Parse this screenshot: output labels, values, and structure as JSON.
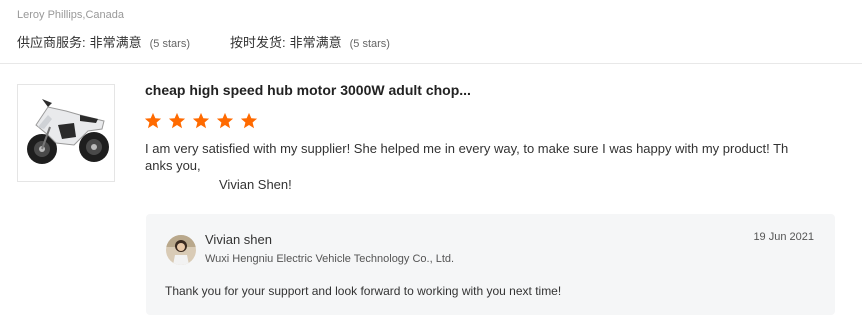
{
  "reviewer": {
    "name_location": "Leroy Phillips,Canada"
  },
  "ratings": [
    {
      "label": "供应商服务:",
      "value": "非常满意",
      "stars_text": "(5 stars)"
    },
    {
      "label": "按时发货:",
      "value": "非常满意",
      "stars_text": "(5 stars)"
    }
  ],
  "product": {
    "title": "cheap high speed hub motor 3000W adult chop...",
    "image_icon": "motorcycle-image"
  },
  "review": {
    "star_count": 5,
    "star_color": "#ff6a00",
    "text": "I am very satisfied with my supplier! She helped me in every way, to make sure I was happy with my product! Thanks you,",
    "signature": "Vivian Shen!"
  },
  "reply": {
    "name": "Vivian shen",
    "company": "Wuxi Hengniu Electric Vehicle Technology Co., Ltd.",
    "date": "19 Jun 2021",
    "text": "Thank you for your support and look forward to working with you next time!"
  }
}
